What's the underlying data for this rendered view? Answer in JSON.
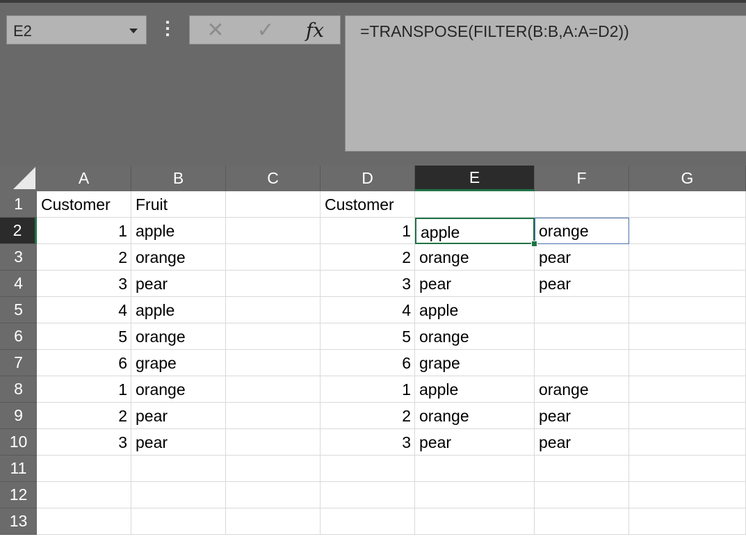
{
  "name_box": {
    "value": "E2"
  },
  "formula_bar": {
    "cancel_icon": "cancel-x-icon",
    "enter_icon": "checkmark-icon",
    "fx_label": "fx",
    "formula": "=TRANSPOSE(FILTER(B:B,A:A=D2))"
  },
  "colors": {
    "accent": "#217346",
    "header_bg": "#6b6b6b",
    "active_header_bg": "#2b2b2b",
    "toolbar_bg": "#696969"
  },
  "grid": {
    "columns": [
      "A",
      "B",
      "C",
      "D",
      "E",
      "F",
      "G"
    ],
    "active_column": "E",
    "active_row": "2",
    "rows": [
      "1",
      "2",
      "3",
      "4",
      "5",
      "6",
      "7",
      "8",
      "9",
      "10",
      "11",
      "12",
      "13"
    ],
    "cells": [
      [
        "Customer",
        "Fruit",
        "",
        "Customer",
        "",
        "",
        ""
      ],
      [
        "1",
        "apple",
        "",
        "1",
        "apple",
        "orange",
        ""
      ],
      [
        "2",
        "orange",
        "",
        "2",
        "orange",
        "pear",
        ""
      ],
      [
        "3",
        "pear",
        "",
        "3",
        "pear",
        "pear",
        ""
      ],
      [
        "4",
        "apple",
        "",
        "4",
        "apple",
        "",
        ""
      ],
      [
        "5",
        "orange",
        "",
        "5",
        "orange",
        "",
        ""
      ],
      [
        "6",
        "grape",
        "",
        "6",
        "grape",
        "",
        ""
      ],
      [
        "1",
        "orange",
        "",
        "1",
        "apple",
        "orange",
        ""
      ],
      [
        "2",
        "pear",
        "",
        "2",
        "orange",
        "pear",
        ""
      ],
      [
        "3",
        "pear",
        "",
        "3",
        "pear",
        "pear",
        ""
      ],
      [
        "",
        "",
        "",
        "",
        "",
        "",
        ""
      ],
      [
        "",
        "",
        "",
        "",
        "",
        "",
        ""
      ],
      [
        "",
        "",
        "",
        "",
        "",
        "",
        ""
      ]
    ]
  }
}
